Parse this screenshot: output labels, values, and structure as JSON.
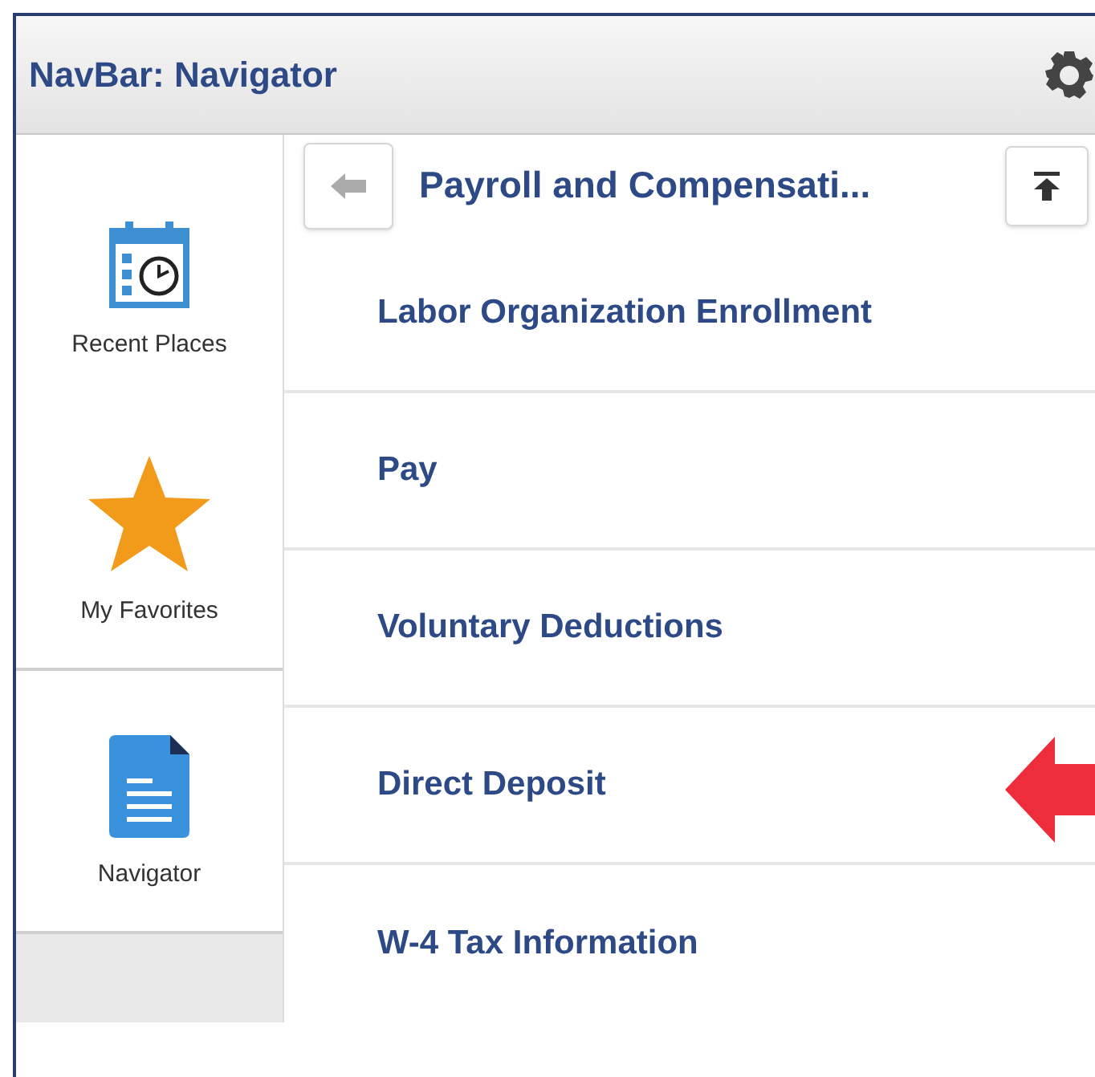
{
  "window": {
    "title": "NavBar: Navigator"
  },
  "sidebar": {
    "items": [
      {
        "label": "Recent Places",
        "kind": "calendar",
        "selected": false
      },
      {
        "label": "My Favorites",
        "kind": "star",
        "selected": false
      },
      {
        "label": "Navigator",
        "kind": "document",
        "selected": true
      }
    ]
  },
  "panel": {
    "title": "Payroll and Compensati...",
    "items": [
      {
        "label": "Labor Organization Enrollment",
        "highlighted": false
      },
      {
        "label": "Pay",
        "highlighted": false
      },
      {
        "label": "Voluntary Deductions",
        "highlighted": false
      },
      {
        "label": "Direct Deposit",
        "highlighted": true
      },
      {
        "label": "W-4 Tax Information",
        "highlighted": false
      }
    ]
  }
}
